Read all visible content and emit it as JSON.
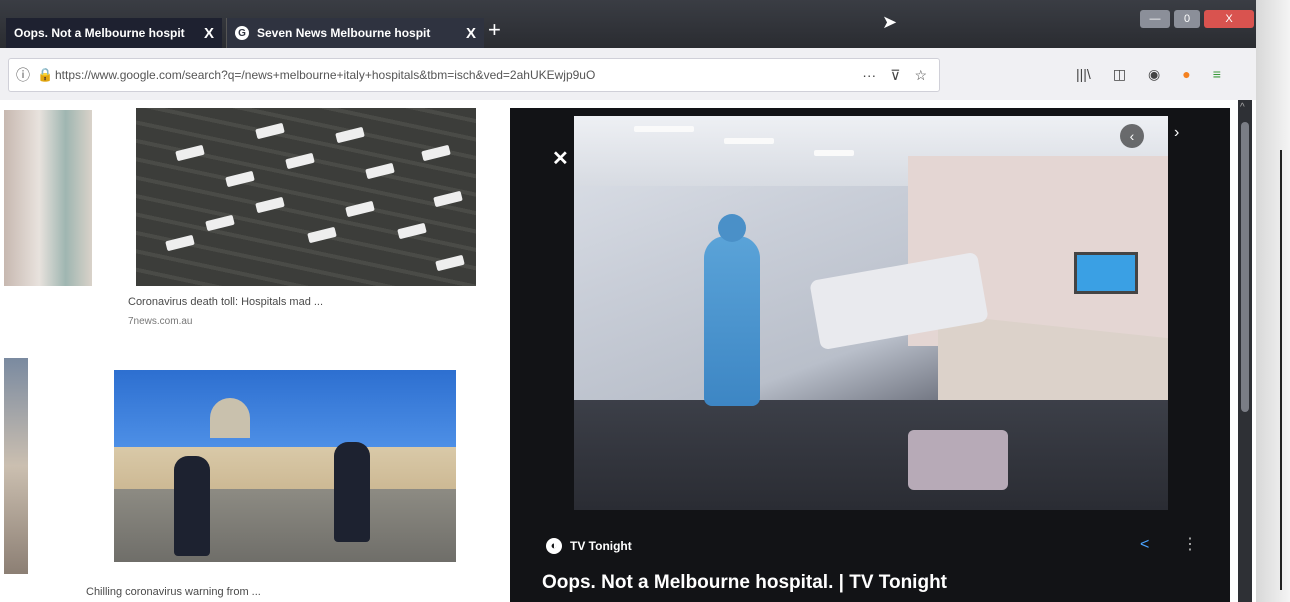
{
  "browser": {
    "tabs": [
      {
        "label": "Oops. Not a Melbourne hospit",
        "close": "X"
      },
      {
        "label": "Seven News Melbourne hospit",
        "close": "X"
      }
    ],
    "new_tab": "+",
    "window_buttons": {
      "minimize": "—",
      "maximize": "0",
      "close": "X"
    },
    "url": "https://www.google.com/search?q=/news+melbourne+italy+hospitals&tbm=isch&ved=2ahUKEwjp9uO",
    "page_actions": [
      "···",
      "pocket-icon",
      "star-icon"
    ],
    "toolbar_icons": [
      "library-icon",
      "sidebar-icon",
      "shield-icon",
      "addon-icon",
      "extension-icon"
    ]
  },
  "results": [
    {
      "caption": "Coronavirus death toll: Hospitals mad ...",
      "source": "7news.com.au"
    },
    {
      "caption": "Chilling coronavirus warning from ..."
    }
  ],
  "viewer": {
    "close": "✕",
    "prev": "‹",
    "next": "›",
    "source": "TV Tonight",
    "title": "Oops. Not a Melbourne hospital. | TV Tonight",
    "share": "<",
    "more": "⋮"
  },
  "colors": {
    "tab_bg": "#2f3340",
    "viewer_bg": "#121316",
    "accent_blue": "#4aa3ff",
    "close_red": "#d9534f"
  }
}
